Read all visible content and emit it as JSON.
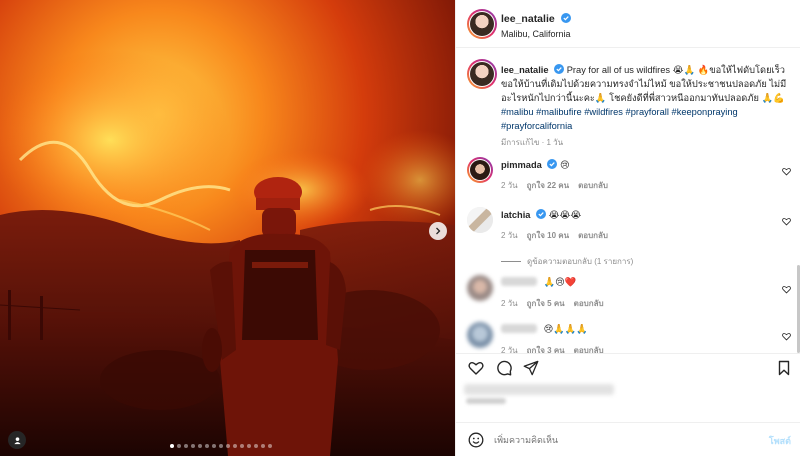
{
  "post": {
    "username": "lee_natalie",
    "location": "Malibu, California",
    "caption": {
      "lead": "Pray for all of us wildfires 😭🙏 🔥ขอให้ไฟดับโดยเร็วขอให้บ้านที่เดิมไปด้วยความทรงจำไม่ไหม้ ขอให้ประชาชนปลอดภัย ไม่มีอะไรหนักไปกว่านี้นะคะ🙏 โชคยังดีที่พี่สาวหนีออกมาทันปลอดภัย 🙏💪 ",
      "hashtags": "#malibu #malibufire #wildfires #prayforall #keeponpraying #prayforcalifornia",
      "meta": "มีการแก้ไข · 1 วัน"
    }
  },
  "comments": [
    {
      "username": "pimmada",
      "text": "😢",
      "age": "2 วัน",
      "likes": "ถูกใจ 22 คน",
      "reply": "ตอบกลับ"
    },
    {
      "username": "latchia",
      "text": "😭😭😭",
      "age": "2 วัน",
      "likes": "ถูกใจ 10 คน",
      "reply": "ตอบกลับ"
    },
    {
      "username": "",
      "text": "🙏😢❤️",
      "age": "2 วัน",
      "likes": "ถูกใจ 5 คน",
      "reply": "ตอบกลับ"
    },
    {
      "username": "",
      "text": "😢🙏🙏🙏",
      "age": "2 วัน",
      "likes": "ถูกใจ 3 คน",
      "reply": "ตอบกลับ"
    }
  ],
  "view_replies": "ดูข้อความตอบกลับ (1 รายการ)",
  "composer": {
    "placeholder": "เพิ่มความคิดเห็น",
    "post_label": "โพสต์"
  },
  "carousel": {
    "slide_count": 15,
    "active_index": 0
  },
  "colors": {
    "verified": "#3897f0",
    "link": "#00376b",
    "post_disabled": "#b2dffc"
  },
  "icons": [
    "verified-icon",
    "heart-icon",
    "comment-icon",
    "share-icon",
    "bookmark-icon",
    "emoji-icon",
    "chevron-right-icon",
    "user-tag-icon"
  ]
}
